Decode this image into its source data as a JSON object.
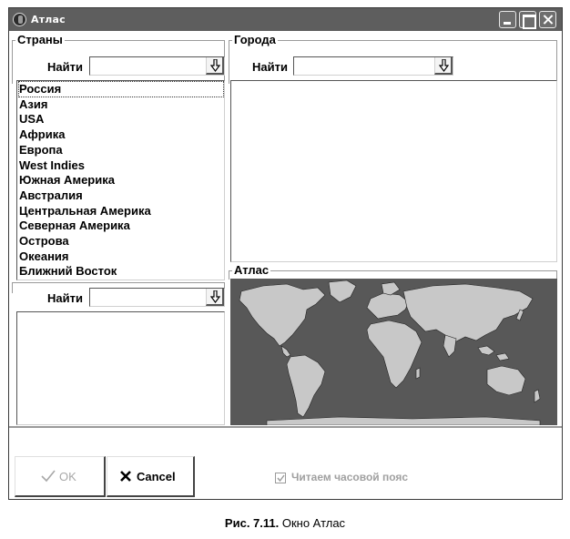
{
  "window": {
    "title": "Атлас"
  },
  "countries": {
    "group_label": "Страны",
    "find_label": "Найти",
    "find_value": "",
    "items": [
      {
        "label": "Россия"
      },
      {
        "label": "Азия"
      },
      {
        "label": "USA"
      },
      {
        "label": "Африка"
      },
      {
        "label": "Европа"
      },
      {
        "label": "West Indies"
      },
      {
        "label": "Южная Америка"
      },
      {
        "label": "Австралия"
      },
      {
        "label": "Центральная Америка"
      },
      {
        "label": "Северная Америка"
      },
      {
        "label": "Острова"
      },
      {
        "label": "Океания"
      },
      {
        "label": "Ближний Восток"
      }
    ],
    "selected_index": 0
  },
  "second_find": {
    "find_label": "Найти",
    "find_value": ""
  },
  "cities": {
    "group_label": "Города",
    "find_label": "Найти",
    "find_value": "",
    "items": []
  },
  "atlas": {
    "group_label": "Атлас"
  },
  "buttons": {
    "ok_label": "OK",
    "cancel_label": "Cancel"
  },
  "timezone_checkbox": {
    "label": "Читаем часовой пояс",
    "checked": true,
    "enabled": false
  },
  "caption": {
    "figure": "Рис. 7.11.",
    "text": "Окно Атлас"
  },
  "colors": {
    "title_bar": "#5e5e5e",
    "ocean": "#585858",
    "land": "#c8c8c8",
    "disabled_text": "#a0a0a0"
  },
  "icons": {
    "combo_button": "arrow-down-icon",
    "ok": "check-mark-icon",
    "cancel": "x-icon"
  }
}
